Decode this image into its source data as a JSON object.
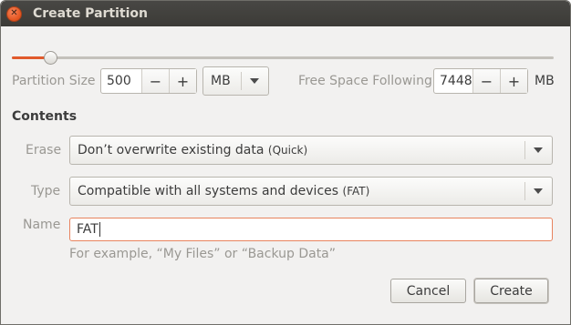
{
  "window": {
    "title": "Create Partition"
  },
  "size": {
    "label": "Partition Size",
    "value": "500",
    "minus": "−",
    "plus": "+",
    "unit": "MB",
    "slider_fraction": 0.07
  },
  "free_space": {
    "label": "Free Space Following",
    "value": "7448",
    "minus": "−",
    "plus": "+",
    "unit": "MB"
  },
  "contents": {
    "heading": "Contents",
    "erase_label": "Erase",
    "erase_value": "Don’t overwrite existing data",
    "erase_note": "(Quick)",
    "type_label": "Type",
    "type_value": "Compatible with all systems and devices",
    "type_note": "(FAT)",
    "name_label": "Name",
    "name_value": "FAT",
    "name_hint": "For example, “My Files” or “Backup Data”"
  },
  "buttons": {
    "cancel": "Cancel",
    "create": "Create"
  },
  "colors": {
    "accent": "#e15a2c",
    "titlebar": "#3c3b37",
    "focus": "#e8835e"
  },
  "icons": {
    "close": "close-icon",
    "dropdown": "chevron-down-icon"
  }
}
